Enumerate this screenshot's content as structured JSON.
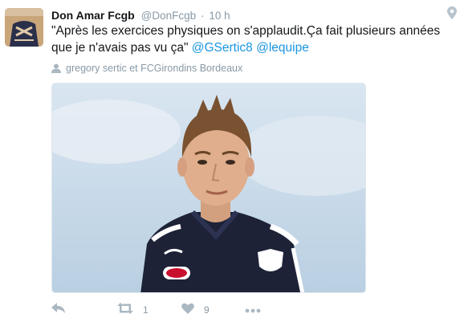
{
  "tweet": {
    "display_name": "Don Amar Fcgb",
    "handle": "@DonFcgb",
    "separator": "·",
    "time": "10 h",
    "text_line1": "\"Après les exercices physiques on s'applaudit.Ça fait plusieurs années",
    "text_line2_prefix": "que je n'avais pas vu ça\" ",
    "mention1": "@GSertic8",
    "mention2": "@lequipe",
    "tagged": "gregory sertic et FCGirondins Bordeaux",
    "retweet_count": "1",
    "like_count": "9"
  },
  "icons": {
    "location": "map-pin-icon",
    "tagged": "person-icon",
    "reply": "reply-icon",
    "retweet": "retweet-icon",
    "like": "heart-icon",
    "more": "more-dots-icon"
  },
  "colors": {
    "link": "#1b95e0",
    "muted": "#8899a6",
    "text": "#14171a"
  }
}
